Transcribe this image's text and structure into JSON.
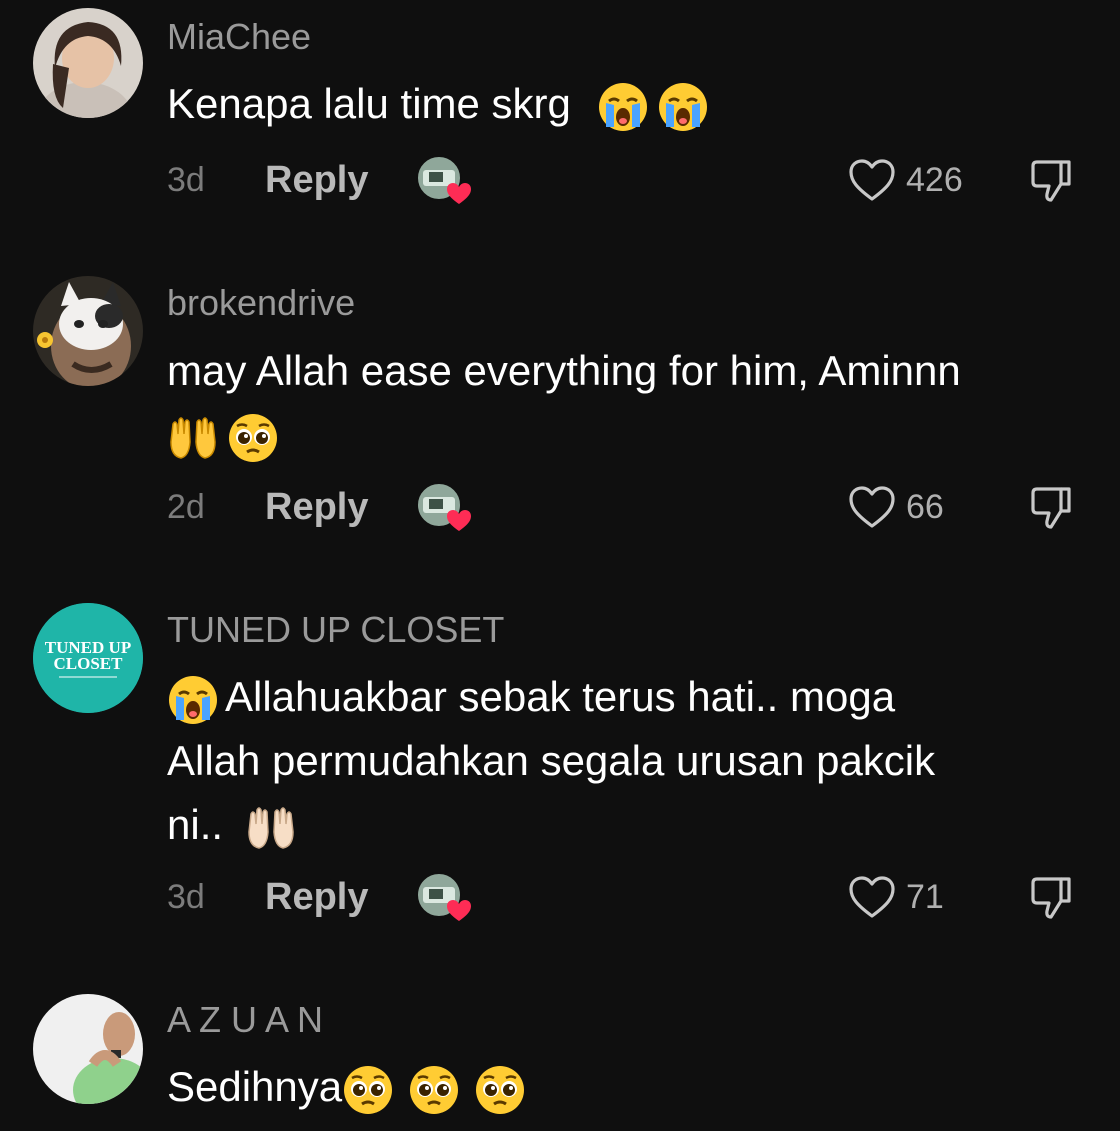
{
  "comments": [
    {
      "username": "MiaChee",
      "line1": "Kenapa lalu time skrg",
      "age": "3d",
      "reply_label": "Reply",
      "likes": "426",
      "avatar_icon": "girl-avatar"
    },
    {
      "username": "brokendrive",
      "line1": "may Allah ease everything for him, Aminnn",
      "age": "2d",
      "reply_label": "Reply",
      "likes": "66",
      "avatar_icon": "cat-face-avatar"
    },
    {
      "username": "TUNED UP CLOSET",
      "line1": "Allahuakbar sebak terus hati.. moga",
      "line2": "Allah permudahkan segala urusan pakcik",
      "line3": "ni..",
      "age": "3d",
      "reply_label": "Reply",
      "likes": "71",
      "avatar_text_1": "TUNED UP",
      "avatar_text_2": "CLOSET",
      "avatar_icon": "brand-logo-avatar"
    },
    {
      "username": "A Z U A N",
      "line1": "Sedihnya",
      "avatar_icon": "man-avatar"
    }
  ],
  "colors": {
    "background": "#0f0f0f",
    "username": "#9a9a9a",
    "heart_red": "#fe2c55",
    "brand_teal": "#1fb5a8"
  },
  "icons": {
    "like": "heart-outline-icon",
    "dislike": "thumbs-down-icon",
    "creator_liked": "creator-liked-heart-icon",
    "loudly_crying": "loudly-crying-face-icon",
    "pleading": "pleading-face-icon",
    "raising_hands": "palms-up-together-icon"
  }
}
